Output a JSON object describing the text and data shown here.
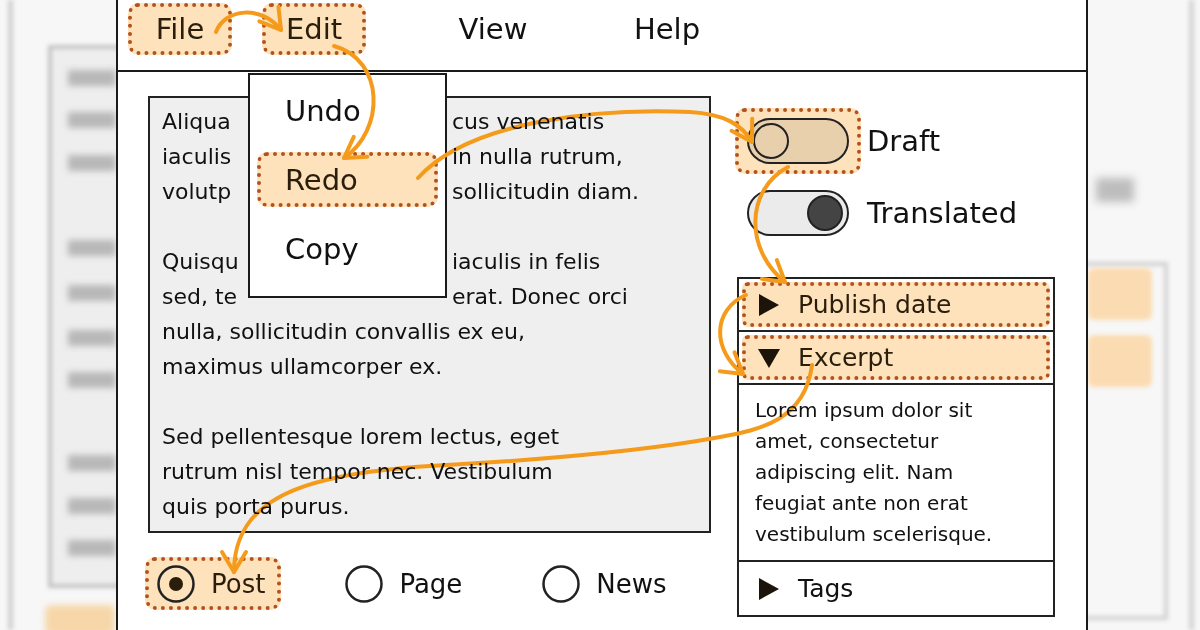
{
  "menubar": [
    {
      "label": "File",
      "highlighted": true
    },
    {
      "label": "Edit",
      "highlighted": true
    },
    {
      "label": "View",
      "highlighted": false
    },
    {
      "label": "Help",
      "highlighted": false
    }
  ],
  "edit_menu": {
    "items": [
      {
        "label": "Undo",
        "highlighted": false
      },
      {
        "label": "Redo",
        "highlighted": true
      },
      {
        "label": "Copy",
        "highlighted": false
      }
    ]
  },
  "editor": {
    "paragraphs": [
      {
        "lines": [
          [
            "Aliqua",
            "cus venenatis"
          ],
          [
            "iaculis",
            "in nulla rutrum,"
          ],
          [
            "volutp",
            "sollicitudin diam."
          ]
        ]
      },
      {
        "lines": [
          [
            "Quisqu",
            "iaculis in felis"
          ],
          [
            "sed, te",
            "erat. Donec orci"
          ],
          [
            "nulla, sollicitudin convallis ex eu,"
          ],
          [
            "maximus ullamcorper ex."
          ]
        ]
      },
      {
        "lines": [
          [
            "Sed pellentesque lorem lectus, eget"
          ],
          [
            "rutrum nisl tempor nec. Vestibulum"
          ],
          [
            "quis porta purus."
          ]
        ]
      }
    ]
  },
  "post_type": [
    {
      "label": "Post",
      "selected": true,
      "highlighted": true
    },
    {
      "label": "Page",
      "selected": false,
      "highlighted": false
    },
    {
      "label": "News",
      "selected": false,
      "highlighted": false
    }
  ],
  "toggles": [
    {
      "label": "Draft",
      "on": false,
      "highlighted": true
    },
    {
      "label": "Translated",
      "on": true,
      "highlighted": false
    }
  ],
  "accordion": [
    {
      "label": "Publish date",
      "expanded": false,
      "highlighted": true
    },
    {
      "label": "Excerpt",
      "expanded": true,
      "highlighted": true,
      "content": "Lorem ipsum dolor sit amet, consectetur adipiscing elit. Nam feugiat ante non erat vestibulum scelerisque."
    },
    {
      "label": "Tags",
      "expanded": false,
      "highlighted": false
    }
  ]
}
